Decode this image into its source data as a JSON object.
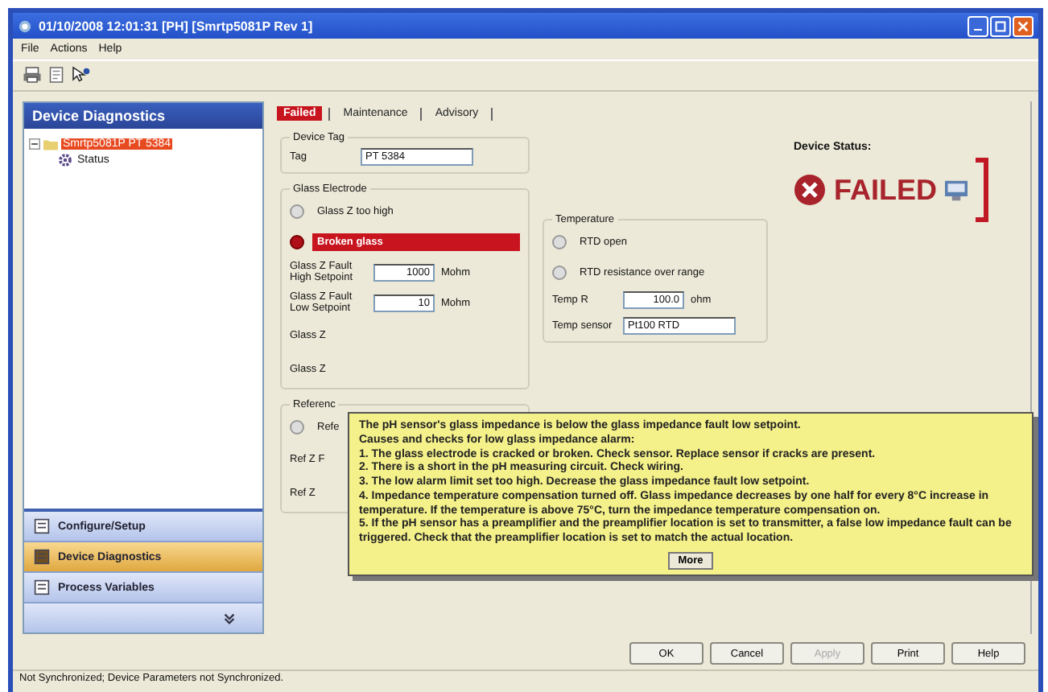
{
  "window": {
    "title": "01/10/2008 12:01:31 [PH] [Smrtp5081P Rev 1]"
  },
  "menu": [
    "File",
    "Actions",
    "Help"
  ],
  "sidebar": {
    "title": "Device Diagnostics",
    "tree": [
      {
        "label": "Smrtp5081P PT 5384",
        "selected": true,
        "expanded": true,
        "children": [
          {
            "label": "Status",
            "selected": false
          }
        ]
      }
    ],
    "nav": [
      {
        "label": "Configure/Setup",
        "selected": false
      },
      {
        "label": "Device Diagnostics",
        "selected": true
      },
      {
        "label": "Process Variables",
        "selected": false
      }
    ]
  },
  "tabs": [
    {
      "label": "Failed",
      "selected": true
    },
    {
      "label": "Maintenance",
      "selected": false
    },
    {
      "label": "Advisory",
      "selected": false
    }
  ],
  "device_tag": {
    "title": "Device Tag",
    "label": "Tag",
    "value": "PT 5384"
  },
  "glass_electrode": {
    "title": "Glass Electrode",
    "alarms": [
      {
        "label": "Glass Z too high",
        "on": false
      },
      {
        "label": "Broken glass",
        "on": true
      }
    ],
    "fields": [
      {
        "label": "Glass Z Fault High Setpoint",
        "value": "1000",
        "unit": "Mohm"
      },
      {
        "label": "Glass Z Fault Low Setpoint",
        "value": "10",
        "unit": "Mohm"
      }
    ],
    "covered": [
      "Glass Z",
      "Glass Z"
    ]
  },
  "reference_electrode": {
    "title": "Referenc",
    "alarm": "Refe",
    "fields": [
      "Ref Z F",
      "Ref Z"
    ]
  },
  "temperature": {
    "title": "Temperature",
    "alarms": [
      {
        "label": "RTD open",
        "on": false
      },
      {
        "label": "RTD resistance over range",
        "on": false
      }
    ],
    "fields": [
      {
        "label": "Temp R",
        "value": "100.0",
        "unit": "ohm"
      },
      {
        "label": "Temp sensor",
        "value": "Pt100 RTD"
      }
    ]
  },
  "device_status": {
    "label": "Device Status:",
    "value": "FAILED"
  },
  "tooltip": {
    "lines": [
      "The pH sensor's glass impedance is below the glass impedance fault low setpoint.",
      "Causes and checks for low glass impedance alarm:",
      "1. The glass electrode is cracked or broken. Check sensor. Replace sensor if cracks are present.",
      "2. There is a short in the pH measuring circuit. Check wiring.",
      "3. The low alarm limit set too high. Decrease the glass impedance fault low setpoint.",
      "4. Impedance temperature compensation turned off. Glass impedance decreases by one half for every 8°C increase in temperature. If the temperature is above 75°C, turn the impedance temperature compensation on.",
      "5. If the pH sensor has a preamplifier and the preamplifier location is set to transmitter, a false low impedance fault can be triggered. Check that the preamplifier location is set to match the actual location."
    ],
    "button": "More"
  },
  "buttons": [
    {
      "label": "OK",
      "disabled": false
    },
    {
      "label": "Cancel",
      "disabled": false
    },
    {
      "label": "Apply",
      "disabled": true
    },
    {
      "label": "Print",
      "disabled": false
    },
    {
      "label": "Help",
      "disabled": false
    }
  ],
  "status_bar": "Not Synchronized; Device Parameters not Synchronized."
}
